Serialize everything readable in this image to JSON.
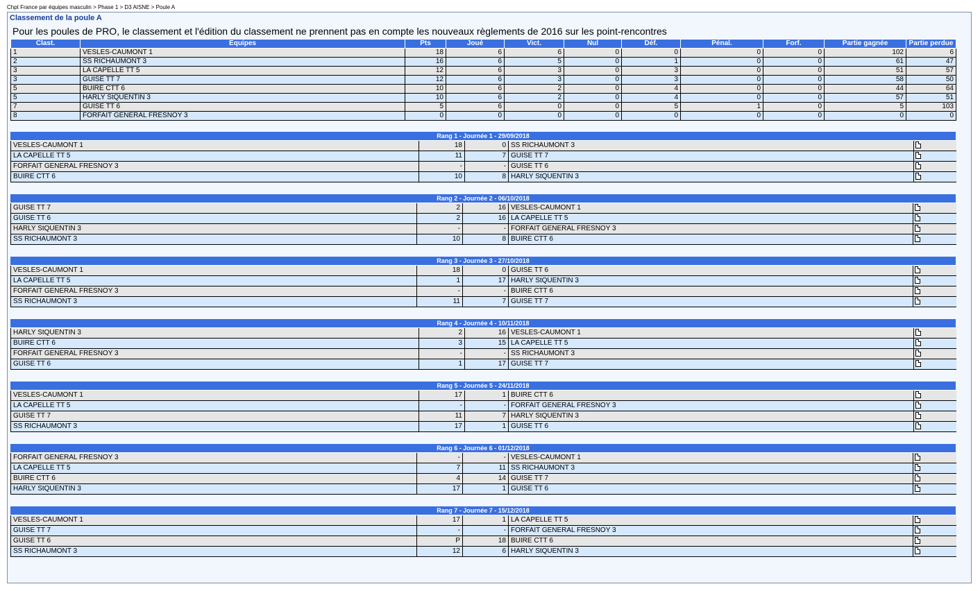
{
  "breadcrumb": "Chpt France par équipes masculin > Phase 1 > D3 AISNE > Poule A",
  "panel_title": "Classement de la poule A",
  "notice": "Pour les poules de PRO, le classement et l'édition du classement ne prennent pas en compte les nouveaux règlements de 2016 sur les point-rencontres",
  "standings": {
    "headers": [
      "Clast.",
      "Equipes",
      "Pts",
      "Joué",
      "Vict.",
      "Nul",
      "Déf.",
      "Pénal.",
      "Forf.",
      "Partie gagnée",
      "Partie perdue"
    ],
    "rows": [
      [
        "1",
        "VESLES-CAUMONT 1",
        "18",
        "6",
        "6",
        "0",
        "0",
        "0",
        "0",
        "102",
        "6"
      ],
      [
        "2",
        "SS RICHAUMONT 3",
        "16",
        "6",
        "5",
        "0",
        "1",
        "0",
        "0",
        "61",
        "47"
      ],
      [
        "3",
        "LA CAPELLE TT 5",
        "12",
        "6",
        "3",
        "0",
        "3",
        "0",
        "0",
        "51",
        "57"
      ],
      [
        "3",
        "GUISE TT 7",
        "12",
        "6",
        "3",
        "0",
        "3",
        "0",
        "0",
        "58",
        "50"
      ],
      [
        "5",
        "BUIRE CTT 6",
        "10",
        "6",
        "2",
        "0",
        "4",
        "0",
        "0",
        "44",
        "64"
      ],
      [
        "5",
        "HARLY StQUENTIN 3",
        "10",
        "6",
        "2",
        "0",
        "4",
        "0",
        "0",
        "57",
        "51"
      ],
      [
        "7",
        "GUISE TT 6",
        "5",
        "6",
        "0",
        "0",
        "5",
        "1",
        "0",
        "5",
        "103"
      ],
      [
        "8",
        "FORFAIT GENERAL FRESNOY 3",
        "0",
        "0",
        "0",
        "0",
        "0",
        "0",
        "0",
        "0",
        "0"
      ]
    ]
  },
  "rounds": [
    {
      "title": "Rang 1 - Journée 1 - 29/09/2018",
      "matches": [
        [
          "VESLES-CAUMONT 1",
          "18",
          "0",
          "SS RICHAUMONT 3"
        ],
        [
          "LA CAPELLE TT 5",
          "11",
          "7",
          "GUISE TT 7"
        ],
        [
          "FORFAIT GENERAL FRESNOY 3",
          "-",
          "-",
          "GUISE TT 6"
        ],
        [
          "BUIRE CTT 6",
          "10",
          "8",
          "HARLY StQUENTIN 3"
        ]
      ]
    },
    {
      "title": "Rang 2 - Journée 2 - 06/10/2018",
      "matches": [
        [
          "GUISE TT 7",
          "2",
          "16",
          "VESLES-CAUMONT 1"
        ],
        [
          "GUISE TT 6",
          "2",
          "16",
          "LA CAPELLE TT 5"
        ],
        [
          "HARLY StQUENTIN 3",
          "-",
          "-",
          "FORFAIT GENERAL FRESNOY 3"
        ],
        [
          "SS RICHAUMONT 3",
          "10",
          "8",
          "BUIRE CTT 6"
        ]
      ]
    },
    {
      "title": "Rang 3 - Journée 3 - 27/10/2018",
      "matches": [
        [
          "VESLES-CAUMONT 1",
          "18",
          "0",
          "GUISE TT 6"
        ],
        [
          "LA CAPELLE TT 5",
          "1",
          "17",
          "HARLY StQUENTIN 3"
        ],
        [
          "FORFAIT GENERAL FRESNOY 3",
          "-",
          "-",
          "BUIRE CTT 6"
        ],
        [
          "SS RICHAUMONT 3",
          "11",
          "7",
          "GUISE TT 7"
        ]
      ]
    },
    {
      "title": "Rang 4 - Journée 4 - 10/11/2018",
      "matches": [
        [
          "HARLY StQUENTIN 3",
          "2",
          "16",
          "VESLES-CAUMONT 1"
        ],
        [
          "BUIRE CTT 6",
          "3",
          "15",
          "LA CAPELLE TT 5"
        ],
        [
          "FORFAIT GENERAL FRESNOY 3",
          "-",
          "-",
          "SS RICHAUMONT 3"
        ],
        [
          "GUISE TT 6",
          "1",
          "17",
          "GUISE TT 7"
        ]
      ]
    },
    {
      "title": "Rang 5 - Journée 5 - 24/11/2018",
      "matches": [
        [
          "VESLES-CAUMONT 1",
          "17",
          "1",
          "BUIRE CTT 6"
        ],
        [
          "LA CAPELLE TT 5",
          "-",
          "-",
          "FORFAIT GENERAL FRESNOY 3"
        ],
        [
          "GUISE TT 7",
          "11",
          "7",
          "HARLY StQUENTIN 3"
        ],
        [
          "SS RICHAUMONT 3",
          "17",
          "1",
          "GUISE TT 6"
        ]
      ]
    },
    {
      "title": "Rang 6 - Journée 6 - 01/12/2018",
      "matches": [
        [
          "FORFAIT GENERAL FRESNOY 3",
          "-",
          "-",
          "VESLES-CAUMONT 1"
        ],
        [
          "LA CAPELLE TT 5",
          "7",
          "11",
          "SS RICHAUMONT 3"
        ],
        [
          "BUIRE CTT 6",
          "4",
          "14",
          "GUISE TT 7"
        ],
        [
          "HARLY StQUENTIN 3",
          "17",
          "1",
          "GUISE TT 6"
        ]
      ]
    },
    {
      "title": "Rang 7 - Journée 7 - 15/12/2018",
      "matches": [
        [
          "VESLES-CAUMONT 1",
          "17",
          "1",
          "LA CAPELLE TT 5"
        ],
        [
          "GUISE TT 7",
          "-",
          "-",
          "FORFAIT GENERAL FRESNOY 3"
        ],
        [
          "GUISE TT 6",
          "P",
          "18",
          "BUIRE CTT 6"
        ],
        [
          "SS RICHAUMONT 3",
          "12",
          "6",
          "HARLY StQUENTIN 3"
        ]
      ]
    }
  ],
  "icons": {
    "match_sheet": "document-icon"
  },
  "colors": {
    "header_blue": "#3a6fe0",
    "row_grey": "#e6e6e6",
    "row_blue": "#d6e8fb",
    "panel_bg": "#f1f7fd",
    "title_blue": "#1b3d9b"
  }
}
